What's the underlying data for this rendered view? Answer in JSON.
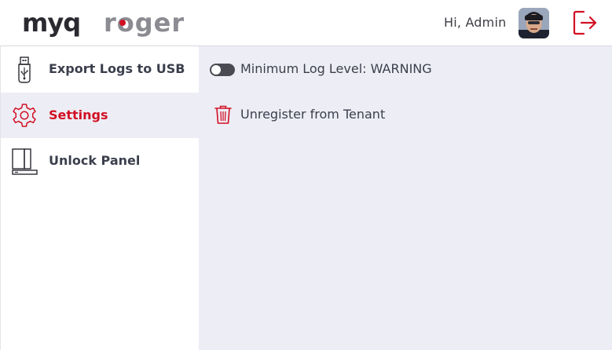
{
  "header": {
    "logo_text": "MYQ roger",
    "greeting": "Hi, Admin",
    "avatar_icon": "user-avatar",
    "logout_icon": "logout-icon"
  },
  "sidebar": {
    "items": [
      {
        "label": "Export Logs to USB",
        "icon": "usb-icon",
        "active": false
      },
      {
        "label": "Settings",
        "icon": "gear-icon",
        "active": true
      },
      {
        "label": "Unlock Panel",
        "icon": "panel-icon",
        "active": false
      }
    ]
  },
  "main": {
    "log_level_label": "Minimum Log Level: WARNING",
    "log_level_toggle_on": false,
    "unregister_label": "Unregister from Tenant"
  },
  "colors": {
    "accent": "#d21024",
    "text": "#3b3f4c",
    "content_background": "#ededf5",
    "active_item_background": "#ededf5"
  }
}
